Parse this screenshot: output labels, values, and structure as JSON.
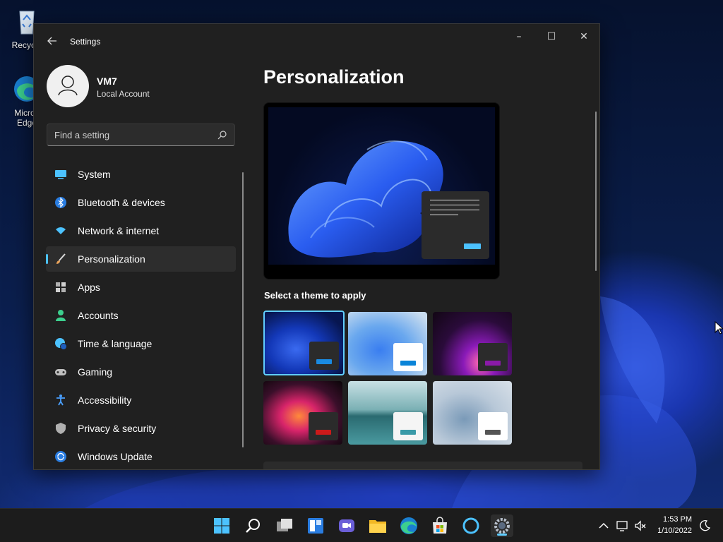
{
  "desktop": {
    "icons": [
      {
        "label": "Recycle",
        "icon": "recycle-bin-icon"
      },
      {
        "label": "Micros\nEdge",
        "icon": "edge-icon"
      }
    ]
  },
  "window": {
    "title": "Settings",
    "controls": {
      "minimize": "–",
      "maximize": "☐",
      "close": "✕"
    }
  },
  "profile": {
    "name": "VM7",
    "account_type": "Local Account"
  },
  "search": {
    "placeholder": "Find a setting"
  },
  "nav": {
    "items": [
      {
        "label": "System",
        "icon": "monitor-icon",
        "color": "#4cc2ff"
      },
      {
        "label": "Bluetooth & devices",
        "icon": "bluetooth-icon",
        "color": "#4aa0ff"
      },
      {
        "label": "Network & internet",
        "icon": "wifi-icon",
        "color": "#4cc2ff"
      },
      {
        "label": "Personalization",
        "icon": "brush-icon",
        "color": "#e8a25a",
        "active": true
      },
      {
        "label": "Apps",
        "icon": "apps-icon",
        "color": "#b0b0b0"
      },
      {
        "label": "Accounts",
        "icon": "person-icon",
        "color": "#3ccf8e"
      },
      {
        "label": "Time & language",
        "icon": "globe-clock-icon",
        "color": "#4cc2ff"
      },
      {
        "label": "Gaming",
        "icon": "gamepad-icon",
        "color": "#c0c0c0"
      },
      {
        "label": "Accessibility",
        "icon": "accessibility-icon",
        "color": "#4aa0ff"
      },
      {
        "label": "Privacy & security",
        "icon": "shield-icon",
        "color": "#b0b0b0"
      },
      {
        "label": "Windows Update",
        "icon": "update-icon",
        "color": "#4cc2ff"
      }
    ]
  },
  "main": {
    "title": "Personalization",
    "themes_heading": "Select a theme to apply",
    "themes": [
      {
        "name": "windows-dark",
        "selected": true,
        "bg": "#0a1a55",
        "mini": "#2b2b2b",
        "bar": "#4cc2ff"
      },
      {
        "name": "windows-light",
        "bg": "#9fc6ea",
        "mini": "#ffffff",
        "bar": "#0a84d8"
      },
      {
        "name": "glow",
        "bg": "#2a0b3a",
        "mini": "#2b2b2b",
        "bar": "#8a1aa8"
      },
      {
        "name": "captured-motion",
        "bg": "#1a0f14",
        "mini": "#2b2b2b",
        "bar": "#cc1a1a"
      },
      {
        "name": "sunrise",
        "bg": "#4a8a8a",
        "mini": "#f5f5f5",
        "bar": "#3a9aa8"
      },
      {
        "name": "flow",
        "bg": "#a8b8c8",
        "mini": "#ffffff",
        "bar": "#555555"
      }
    ]
  },
  "taskbar": {
    "apps": [
      "start-icon",
      "search-icon",
      "task-view-icon",
      "widgets-icon",
      "teams-chat-icon",
      "file-explorer-icon",
      "edge-icon",
      "store-icon",
      "cortana-icon",
      "settings-icon"
    ],
    "time": "1:53 PM",
    "date": "1/10/2022"
  }
}
